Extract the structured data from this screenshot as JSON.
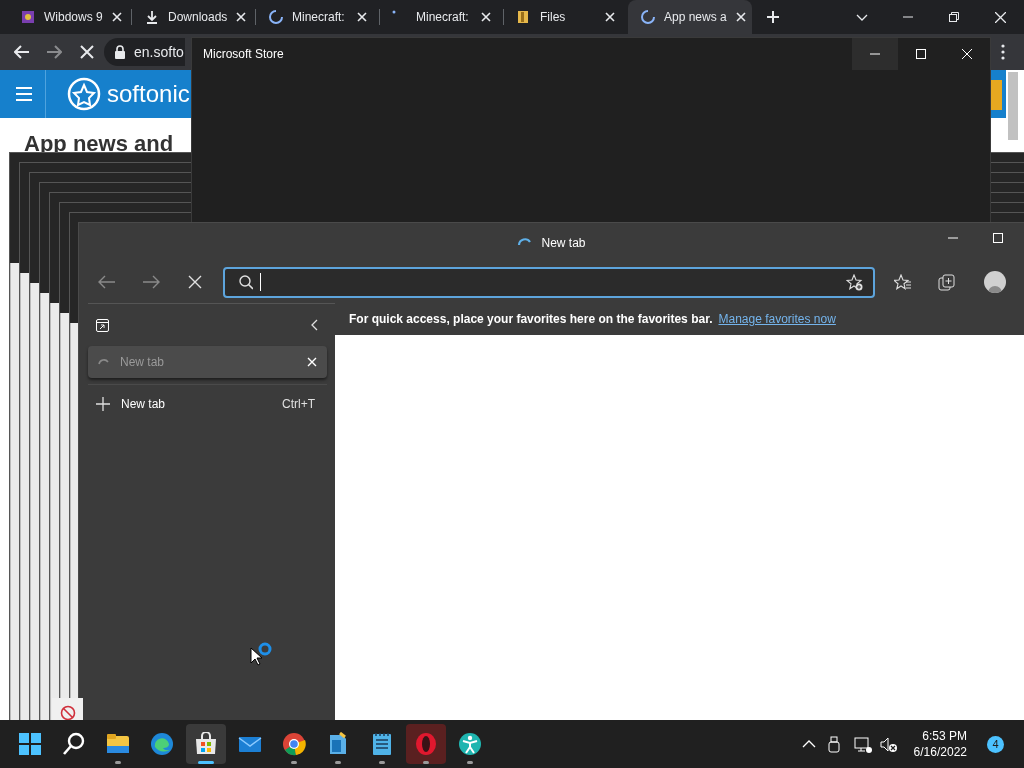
{
  "chrome": {
    "tabs": [
      {
        "title": "Wibdows 9",
        "kind": "app",
        "selected": false
      },
      {
        "title": "Downloads",
        "kind": "download",
        "selected": false
      },
      {
        "title": "Minecraft:",
        "kind": "spinner",
        "selected": false
      },
      {
        "title": "Minecraft:",
        "kind": "dot",
        "selected": false
      },
      {
        "title": "Files",
        "kind": "folder",
        "selected": false
      },
      {
        "title": "App news a",
        "kind": "spinner",
        "selected": true
      }
    ],
    "address": "en.softo",
    "loading": true,
    "site": {
      "logo": "softonic",
      "heading": "App news and"
    }
  },
  "store_window": {
    "title": "Microsoft Store"
  },
  "edge_window": {
    "title": "New tab",
    "loading": true,
    "favorites_bar": {
      "message": "For quick access, place your favorites here on the favorites bar.",
      "link": "Manage favorites now"
    },
    "vertical_tabs": [
      {
        "title": "New tab",
        "selected": true
      }
    ],
    "new_tab": {
      "label": "New tab",
      "shortcut": "Ctrl+T"
    }
  },
  "taskbar": {
    "apps": [
      {
        "kind": "start",
        "running": false,
        "selected": false
      },
      {
        "kind": "search",
        "running": false,
        "selected": false
      },
      {
        "kind": "explorer",
        "running": true,
        "selected": false
      },
      {
        "kind": "edge",
        "running": false,
        "selected": false
      },
      {
        "kind": "store",
        "running": true,
        "selected": true
      },
      {
        "kind": "mail",
        "running": false,
        "selected": false
      },
      {
        "kind": "chrome",
        "running": true,
        "selected": false
      },
      {
        "kind": "reader",
        "running": true,
        "selected": false
      },
      {
        "kind": "notepad",
        "running": true,
        "selected": false
      },
      {
        "kind": "opera",
        "running": true,
        "selected": false,
        "flashing": true
      },
      {
        "kind": "accessibility",
        "running": true,
        "selected": false
      }
    ],
    "time": "6:53 PM",
    "date": "6/16/2022",
    "notifications": "4"
  }
}
